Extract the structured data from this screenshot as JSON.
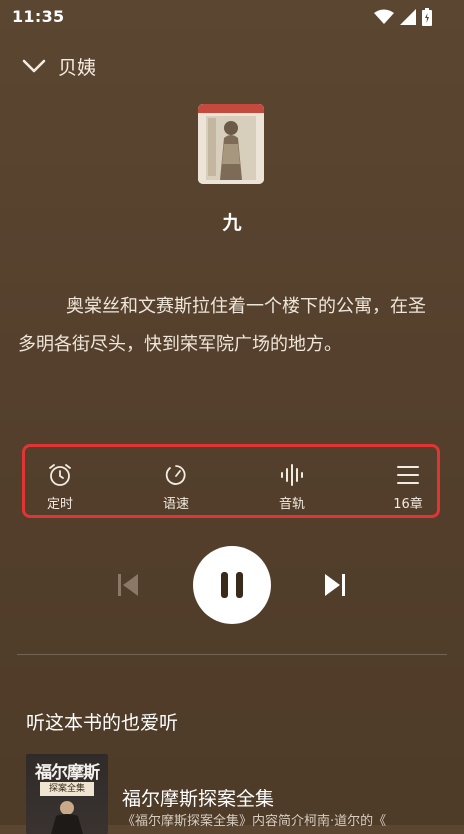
{
  "status_bar": {
    "time": "11:35"
  },
  "header": {
    "title": "贝姨"
  },
  "chapter": {
    "title": "九"
  },
  "excerpt": {
    "text": "奥棠丝和文赛斯拉住着一个楼下的公寓，在圣多明各街尽头，快到荣军院广场的地方。"
  },
  "controls": [
    {
      "label": "定时",
      "icon": "alarm-clock-icon"
    },
    {
      "label": "语速",
      "icon": "speed-gauge-icon"
    },
    {
      "label": "音轨",
      "icon": "audio-waveform-icon"
    },
    {
      "label": "16章",
      "icon": "chapter-list-icon"
    }
  ],
  "recommendations": {
    "section_title": "听这本书的也爱听",
    "items": [
      {
        "cover_title": "福尔摩斯",
        "cover_subtitle": "探案全集",
        "title": "福尔摩斯探案全集",
        "description": "《福尔摩斯探案全集》内容简介柯南·道尔的《"
      }
    ]
  },
  "colors": {
    "highlight_border": "#e23434",
    "background": "#54402c"
  }
}
